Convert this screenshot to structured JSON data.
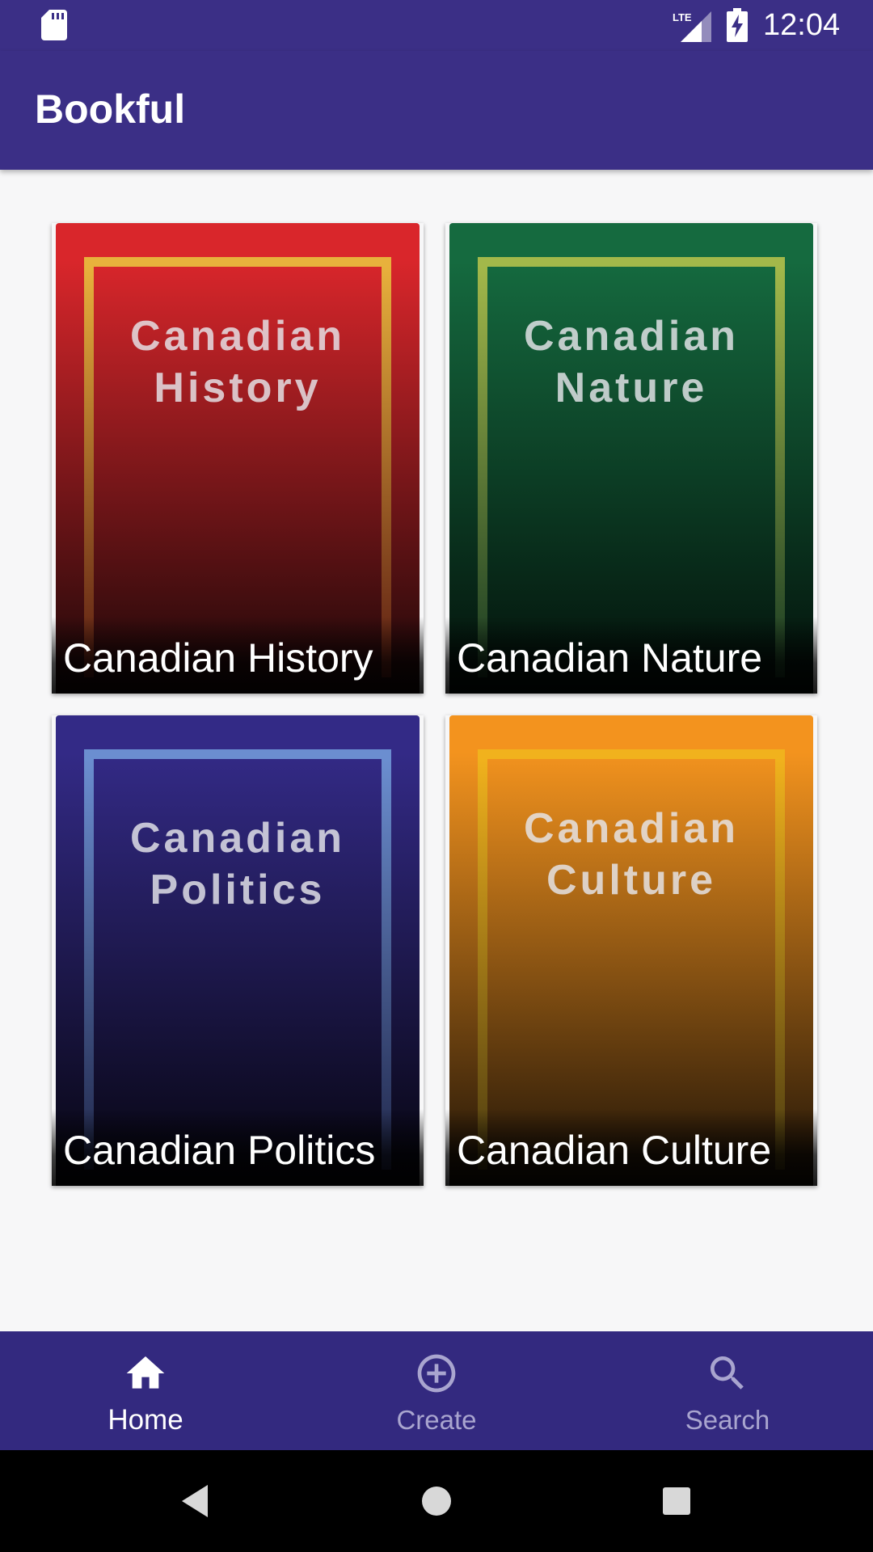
{
  "status_bar": {
    "time": "12:04",
    "network": "LTE",
    "icons": [
      "sd-card-icon",
      "lte-signal-icon",
      "battery-charging-icon"
    ]
  },
  "app_bar": {
    "title": "Bookful"
  },
  "categories": [
    {
      "caption": "Canadian History",
      "cover_text": "Canadian\nHistory",
      "top_color": "#d9262b",
      "bottom_color": "#1a0708",
      "frame_top": "#e8b13c",
      "frame_bottom": "#5a1a12"
    },
    {
      "caption": "Canadian Nature",
      "cover_text": "Canadian\nNature",
      "top_color": "#156a3f",
      "bottom_color": "#03100a",
      "frame_top": "#a3b84a",
      "frame_bottom": "#173a22"
    },
    {
      "caption": "Canadian Politics",
      "cover_text": "Canadian\nPolitics",
      "top_color": "#332a86",
      "bottom_color": "#06050f",
      "frame_top": "#6b8ed0",
      "frame_bottom": "#20264a"
    },
    {
      "caption": "Canadian Culture",
      "cover_text": "Canadian\nCulture",
      "top_color": "#f3931e",
      "bottom_color": "#1d1207",
      "frame_top": "#f1b21d",
      "frame_bottom": "#4a3a10"
    }
  ],
  "bottom_nav": {
    "items": [
      {
        "label": "Home",
        "icon": "home-icon",
        "selected": true
      },
      {
        "label": "Create",
        "icon": "add-circle-icon",
        "selected": false
      },
      {
        "label": "Search",
        "icon": "search-icon",
        "selected": false
      }
    ],
    "active_color": "#ffffff",
    "inactive_color": "#a9a5cf"
  },
  "system_nav": {
    "buttons": [
      "back-icon",
      "home-circle-icon",
      "recents-icon"
    ]
  },
  "colors": {
    "primary": "#3b2f86",
    "background": "#f7f7f8"
  }
}
